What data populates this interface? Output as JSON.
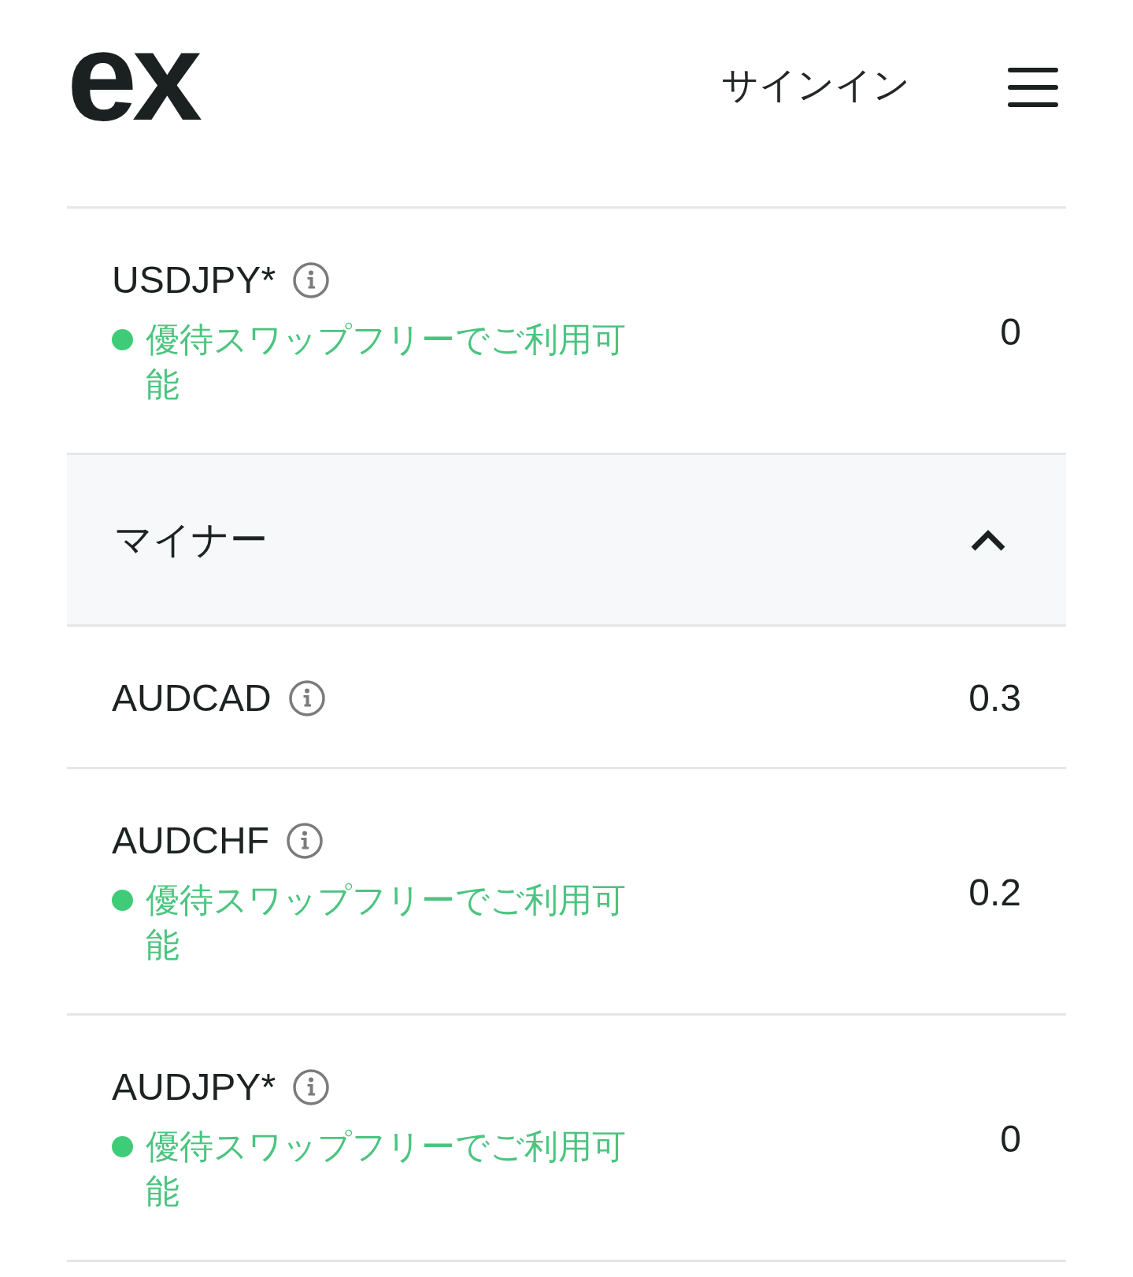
{
  "header": {
    "logo": "ex",
    "sign_in": "サインイン"
  },
  "sections": [
    {
      "rows": [
        {
          "symbol": "USDJPY*",
          "note": "優待スワップフリーでご利用可能",
          "value": "0"
        }
      ]
    },
    {
      "title": "マイナー",
      "expanded": true,
      "rows": [
        {
          "symbol": "AUDCAD",
          "value": "0.3"
        },
        {
          "symbol": "AUDCHF",
          "note": "優待スワップフリーでご利用可能",
          "value": "0.2"
        },
        {
          "symbol": "AUDJPY*",
          "note": "優待スワップフリーでご利用可能",
          "value": "0"
        }
      ]
    }
  ]
}
